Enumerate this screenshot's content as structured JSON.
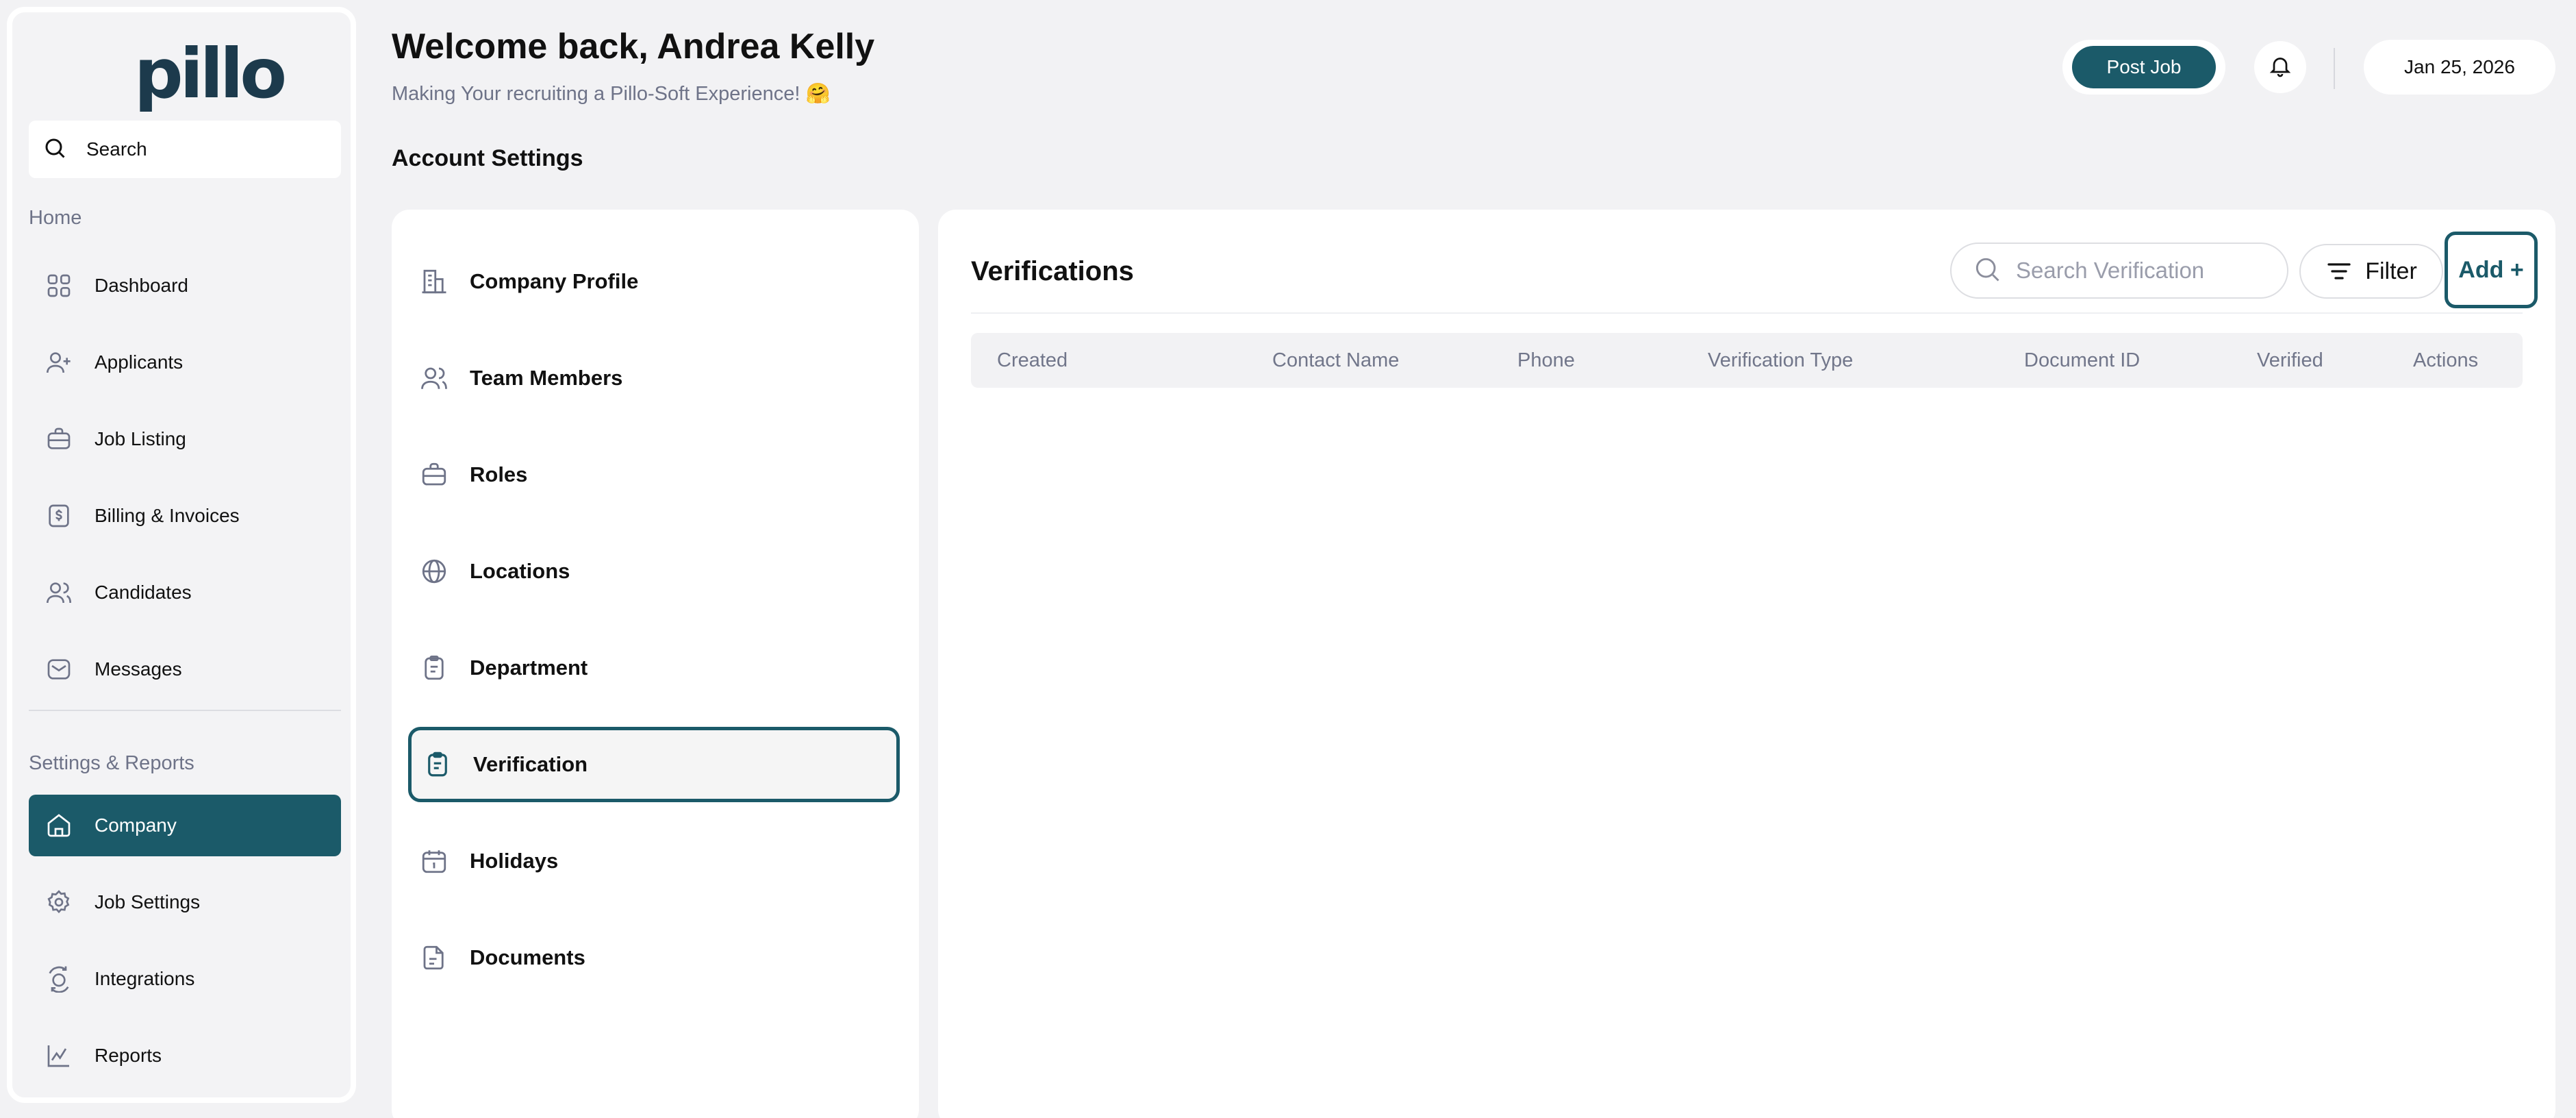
{
  "app": {
    "logo_text": "pillo"
  },
  "sidebar": {
    "search_label": "Search",
    "home_section": "Home",
    "home_items": [
      {
        "label": "Dashboard",
        "icon": "grid-icon"
      },
      {
        "label": "Applicants",
        "icon": "user-plus-icon"
      },
      {
        "label": "Job Listing",
        "icon": "briefcase-icon"
      },
      {
        "label": "Billing & Invoices",
        "icon": "dollar-icon"
      },
      {
        "label": "Candidates",
        "icon": "users-icon"
      },
      {
        "label": "Messages",
        "icon": "mail-icon"
      }
    ],
    "settings_section": "Settings & Reports",
    "settings_items": [
      {
        "label": "Company",
        "icon": "home-icon",
        "active": true
      },
      {
        "label": "Job Settings",
        "icon": "gear-icon"
      },
      {
        "label": "Integrations",
        "icon": "integration-icon"
      },
      {
        "label": "Reports",
        "icon": "chart-icon"
      }
    ]
  },
  "header": {
    "welcome": "Welcome back, Andrea Kelly",
    "subtitle": "Making Your recruiting a Pillo-Soft Experience! 🤗",
    "post_job": "Post Job",
    "date": "Jan 25, 2026"
  },
  "page": {
    "heading": "Account Settings"
  },
  "settings_menu": [
    {
      "label": "Company Profile",
      "icon": "building-icon"
    },
    {
      "label": "Team Members",
      "icon": "team-icon"
    },
    {
      "label": "Roles",
      "icon": "briefcase-icon"
    },
    {
      "label": "Locations",
      "icon": "globe-icon"
    },
    {
      "label": "Department",
      "icon": "clipboard-icon"
    },
    {
      "label": "Verification",
      "icon": "clipboard-check-icon",
      "active": true
    },
    {
      "label": "Holidays",
      "icon": "calendar-icon"
    },
    {
      "label": "Documents",
      "icon": "document-icon"
    }
  ],
  "verifications": {
    "title": "Verifications",
    "search_placeholder": "Search Verification",
    "filter_label": "Filter",
    "add_label": "Add +",
    "columns": [
      "Created",
      "Contact Name",
      "Phone",
      "Verification Type",
      "Document ID",
      "Verified",
      "Actions"
    ],
    "rows": []
  },
  "colors": {
    "accent": "#1b5a69",
    "background": "#f2f2f4",
    "muted_text": "#6e7388"
  }
}
